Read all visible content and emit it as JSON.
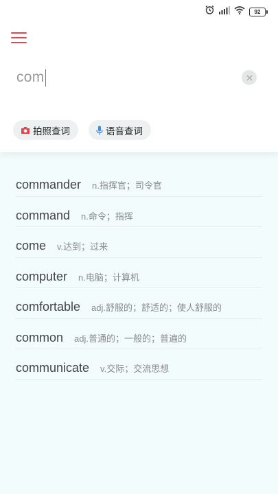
{
  "status_bar": {
    "battery": "92",
    "icons": [
      "alarm-icon",
      "signal-icon",
      "wifi-icon",
      "battery-icon"
    ]
  },
  "header": {
    "menu_icon": "hamburger-menu-icon"
  },
  "search": {
    "value": "com",
    "clear_icon": "close-icon"
  },
  "quick_actions": [
    {
      "label": "拍照查词",
      "icon": "camera-icon",
      "icon_color": "#e2474f"
    },
    {
      "label": "语音查词",
      "icon": "microphone-icon",
      "icon_color": "#3b8de6"
    }
  ],
  "results": [
    {
      "word": "commander",
      "definition": "n.指挥官；司令官"
    },
    {
      "word": "command",
      "definition": "n.命令；指挥"
    },
    {
      "word": "come",
      "definition": "v.达到；过来"
    },
    {
      "word": "computer",
      "definition": "n.电脑；计算机"
    },
    {
      "word": "comfortable",
      "definition": "adj.舒服的；舒适的；使人舒服的"
    },
    {
      "word": "common",
      "definition": "adj.普通的；一般的；普遍的"
    },
    {
      "word": "communicate",
      "definition": "v.交际；交流思想"
    }
  ],
  "colors": {
    "accent": "#e2474f",
    "background": "#f2fcfc"
  }
}
